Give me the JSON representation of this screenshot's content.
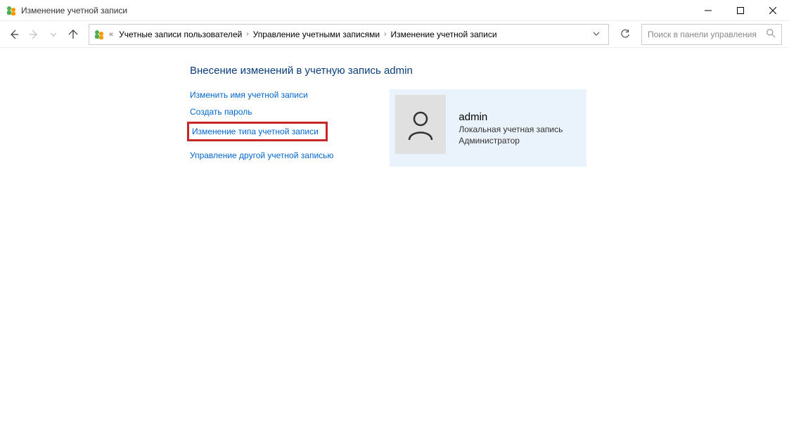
{
  "window": {
    "title": "Изменение учетной записи"
  },
  "breadcrumb": {
    "items": [
      "Учетные записи пользователей",
      "Управление учетными записями",
      "Изменение учетной записи"
    ]
  },
  "search": {
    "placeholder": "Поиск в панели управления"
  },
  "page": {
    "heading": "Внесение изменений в учетную запись admin"
  },
  "links": {
    "rename": "Изменить имя учетной записи",
    "create_password": "Создать пароль",
    "change_type": "Изменение типа учетной записи",
    "manage_other": "Управление другой учетной записью"
  },
  "account": {
    "name": "admin",
    "type_line": "Локальная учетная запись",
    "role": "Администратор"
  }
}
